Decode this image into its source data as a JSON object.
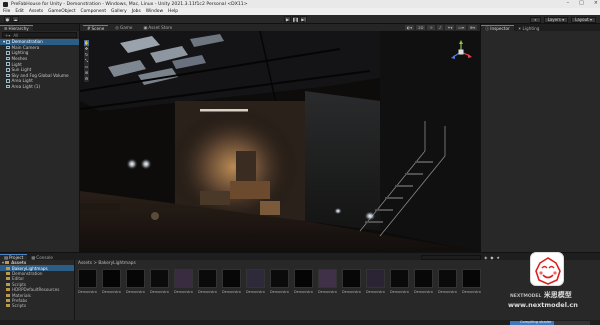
{
  "window": {
    "title": "PreFabHouse for Unity - Demonstration - Windows, Mac, Linux - Unity 2021.3.11f1c2 Personal <DX11>"
  },
  "menu": [
    "File",
    "Edit",
    "Assets",
    "GameObject",
    "Component",
    "Gallery",
    "Jobs",
    "Window",
    "Help"
  ],
  "toolbar": {
    "layers_label": "Layers",
    "layout_label": "Layout"
  },
  "scene_tabs": [
    "Scene",
    "Game",
    "Asset Store"
  ],
  "scene_toolbar": {
    "persp_label": "2D"
  },
  "hierarchy": {
    "tab_label": "Hierarchy",
    "search_placeholder": "All",
    "root": "Demonstration",
    "items": [
      "Main Camera",
      "Lighting",
      "Meshes",
      "Light",
      "Sun Light",
      "Sky and Fog Global Volume",
      "Area Light",
      "Area Light (1)"
    ]
  },
  "inspector": {
    "tabs": [
      "Inspector",
      "Lighting"
    ]
  },
  "project": {
    "tabs": [
      "Project",
      "Console"
    ],
    "search_placeholder": "",
    "tree": [
      "Assets",
      "BakeryLightmaps",
      "Demonstration",
      "Editor",
      "Scripts",
      "HDRPDefaultResources",
      "Materials",
      "Prefabs",
      "Scripts"
    ],
    "breadcrumb": "Assets > BakeryLightmaps",
    "assets": [
      "Demonstra...",
      "Demonstra...",
      "Demonstra...",
      "Demonstra...",
      "Demonstra...",
      "Demonstra...",
      "Demonstra...",
      "Demonstra...",
      "Demonstra...",
      "Demonstra...",
      "Demonstra...",
      "Demonstra...",
      "Demonstra...",
      "Demonstra...",
      "Demonstra...",
      "Demonstra...",
      "Demonstra..."
    ],
    "asset_colors": [
      "#080808",
      "#050505",
      "#060606",
      "#0b0b0b",
      "#3a2c40",
      "#0a0a0a",
      "#070707",
      "#2e2a3a",
      "#0b0b0b",
      "#050505",
      "#403048",
      "#070707",
      "#2a2434",
      "#0a0a0a",
      "#080808",
      "#0a0a0a",
      "#060606"
    ]
  },
  "status": {
    "progress_label": "Compiling shader",
    "progress": 0.55
  },
  "watermark": {
    "brand": "NEXTMODEL",
    "line1": "米思模型",
    "line2": "www.nextmodel.cn"
  }
}
